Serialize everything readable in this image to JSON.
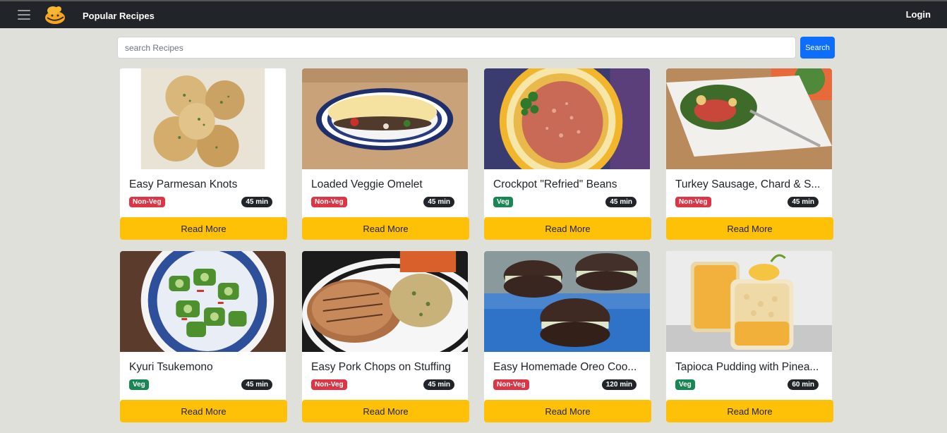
{
  "navbar": {
    "brand": "Popular Recipes",
    "login": "Login"
  },
  "search": {
    "placeholder": "search Recipes",
    "value": "",
    "button": "Search"
  },
  "cards": [
    {
      "title": "Easy Parmesan Knots",
      "type": "Non-Veg",
      "time": "45 min",
      "button": "Read More"
    },
    {
      "title": "Loaded Veggie Omelet",
      "type": "Non-Veg",
      "time": "45 min",
      "button": "Read More"
    },
    {
      "title": "Crockpot \"Refried\" Beans",
      "type": "Veg",
      "time": "45 min",
      "button": "Read More"
    },
    {
      "title": "Turkey Sausage, Chard & S...",
      "type": "Non-Veg",
      "time": "45 min",
      "button": "Read More"
    },
    {
      "title": "Kyuri Tsukemono",
      "type": "Veg",
      "time": "45 min",
      "button": "Read More"
    },
    {
      "title": "Easy Pork Chops on Stuffing",
      "type": "Non-Veg",
      "time": "45 min",
      "button": "Read More"
    },
    {
      "title": "Easy Homemade Oreo Coo...",
      "type": "Non-Veg",
      "time": "120 min",
      "button": "Read More"
    },
    {
      "title": "Tapioca Pudding with Pinea...",
      "type": "Veg",
      "time": "60 min",
      "button": "Read More"
    }
  ],
  "colors": {
    "navbar": "#212529",
    "page_bg": "#dfe0da",
    "accent_button": "#ffc107",
    "search_button": "#0d6efd",
    "non_veg_badge": "#dc3545",
    "veg_badge": "#198754"
  }
}
